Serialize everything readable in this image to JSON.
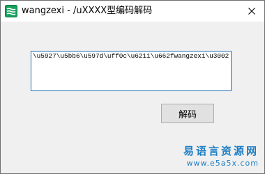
{
  "window": {
    "title": "wangzexi - /uXXXX型编码解码",
    "icon": "e-language-app-icon"
  },
  "editor": {
    "value": "\\u5927\\u5bb6\\u597d\\uff0c\\u6211\\u662fwangzexi\\u3002"
  },
  "actions": {
    "decode_label": "解码"
  },
  "watermark": {
    "brand": "易语言资源网",
    "url": "www.e5a5x.com"
  },
  "colors": {
    "accent": "#1e6fb8",
    "watermark": "#1e7fc4",
    "window_bg": "#f0f0f0"
  }
}
